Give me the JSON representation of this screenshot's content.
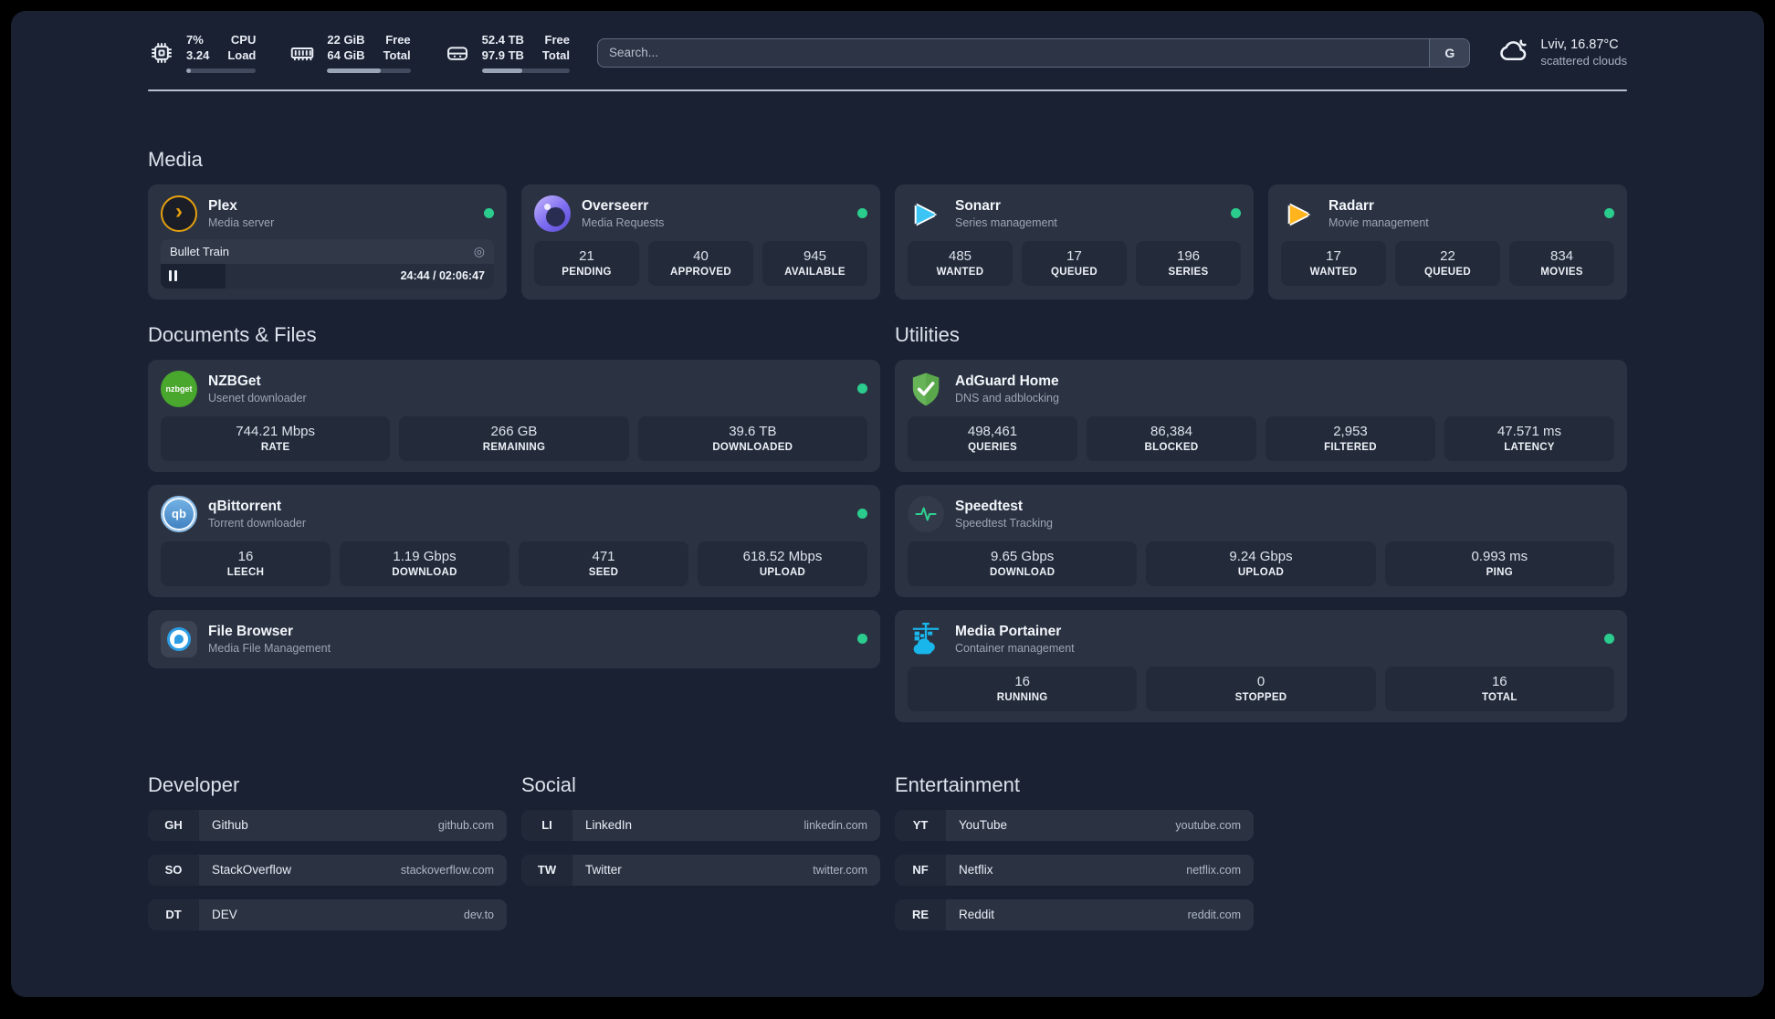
{
  "header": {
    "stats": [
      {
        "name": "cpu",
        "values": [
          "7%",
          "3.24"
        ],
        "labels": [
          "CPU",
          "Load"
        ],
        "progress": 7
      },
      {
        "name": "memory",
        "values": [
          "22 GiB",
          "64 GiB"
        ],
        "labels": [
          "Free",
          "Total"
        ],
        "progress": 64
      },
      {
        "name": "storage",
        "values": [
          "52.4 TB",
          "97.9 TB"
        ],
        "labels": [
          "Free",
          "Total"
        ],
        "progress": 46
      }
    ],
    "search": {
      "placeholder": "Search...",
      "engine": "G"
    },
    "weather": {
      "title": "Lviv, 16.87°C",
      "subtitle": "scattered clouds"
    }
  },
  "sections": {
    "media": "Media",
    "documents": "Documents & Files",
    "utilities": "Utilities",
    "developer": "Developer",
    "social": "Social",
    "entertainment": "Entertainment"
  },
  "apps": {
    "plex": {
      "name": "Plex",
      "subtitle": "Media server",
      "player": {
        "title": "Bullet Train",
        "time": "24:44 / 02:06:47",
        "progress": 19.5
      }
    },
    "overseerr": {
      "name": "Overseerr",
      "subtitle": "Media Requests",
      "stats": [
        {
          "value": "21",
          "label": "PENDING"
        },
        {
          "value": "40",
          "label": "APPROVED"
        },
        {
          "value": "945",
          "label": "AVAILABLE"
        }
      ]
    },
    "sonarr": {
      "name": "Sonarr",
      "subtitle": "Series management",
      "stats": [
        {
          "value": "485",
          "label": "WANTED"
        },
        {
          "value": "17",
          "label": "QUEUED"
        },
        {
          "value": "196",
          "label": "SERIES"
        }
      ]
    },
    "radarr": {
      "name": "Radarr",
      "subtitle": "Movie management",
      "stats": [
        {
          "value": "17",
          "label": "WANTED"
        },
        {
          "value": "22",
          "label": "QUEUED"
        },
        {
          "value": "834",
          "label": "MOVIES"
        }
      ]
    },
    "nzbget": {
      "name": "NZBGet",
      "subtitle": "Usenet downloader",
      "logo_text": "nzbget",
      "stats": [
        {
          "value": "744.21 Mbps",
          "label": "RATE"
        },
        {
          "value": "266 GB",
          "label": "REMAINING"
        },
        {
          "value": "39.6 TB",
          "label": "DOWNLOADED"
        }
      ]
    },
    "qbittorrent": {
      "name": "qBittorrent",
      "subtitle": "Torrent downloader",
      "logo_text": "qb",
      "stats": [
        {
          "value": "16",
          "label": "LEECH"
        },
        {
          "value": "1.19 Gbps",
          "label": "DOWNLOAD"
        },
        {
          "value": "471",
          "label": "SEED"
        },
        {
          "value": "618.52 Mbps",
          "label": "UPLOAD"
        }
      ]
    },
    "filebrowser": {
      "name": "File Browser",
      "subtitle": "Media File Management"
    },
    "adguard": {
      "name": "AdGuard Home",
      "subtitle": "DNS and adblocking",
      "stats": [
        {
          "value": "498,461",
          "label": "QUERIES"
        },
        {
          "value": "86,384",
          "label": "BLOCKED"
        },
        {
          "value": "2,953",
          "label": "FILTERED"
        },
        {
          "value": "47.571 ms",
          "label": "LATENCY"
        }
      ]
    },
    "speedtest": {
      "name": "Speedtest",
      "subtitle": "Speedtest Tracking",
      "stats": [
        {
          "value": "9.65 Gbps",
          "label": "DOWNLOAD"
        },
        {
          "value": "9.24 Gbps",
          "label": "UPLOAD"
        },
        {
          "value": "0.993 ms",
          "label": "PING"
        }
      ]
    },
    "portainer": {
      "name": "Media Portainer",
      "subtitle": "Container management",
      "stats": [
        {
          "value": "16",
          "label": "RUNNING"
        },
        {
          "value": "0",
          "label": "STOPPED"
        },
        {
          "value": "16",
          "label": "TOTAL"
        }
      ]
    }
  },
  "links": {
    "developer": [
      {
        "abbr": "GH",
        "name": "Github",
        "url": "github.com"
      },
      {
        "abbr": "SO",
        "name": "StackOverflow",
        "url": "stackoverflow.com"
      },
      {
        "abbr": "DT",
        "name": "DEV",
        "url": "dev.to"
      }
    ],
    "social": [
      {
        "abbr": "LI",
        "name": "LinkedIn",
        "url": "linkedin.com"
      },
      {
        "abbr": "TW",
        "name": "Twitter",
        "url": "twitter.com"
      }
    ],
    "entertainment": [
      {
        "abbr": "YT",
        "name": "YouTube",
        "url": "youtube.com"
      },
      {
        "abbr": "NF",
        "name": "Netflix",
        "url": "netflix.com"
      },
      {
        "abbr": "RE",
        "name": "Reddit",
        "url": "reddit.com"
      }
    ]
  },
  "colors": {
    "background": "#1a2133",
    "card": "#2b3343",
    "tile": "#232b3b",
    "status_online": "#2acd8d",
    "plex": "#e6a00e",
    "sonarr": "#3cc5f4",
    "radarr": "#ffb41e",
    "nzbget": "#4aa72e",
    "qbittorrent": "#4f9bd8",
    "adguard": "#67b357",
    "portainer": "#18b6eb",
    "filebrowser": "#2d9ce3"
  }
}
